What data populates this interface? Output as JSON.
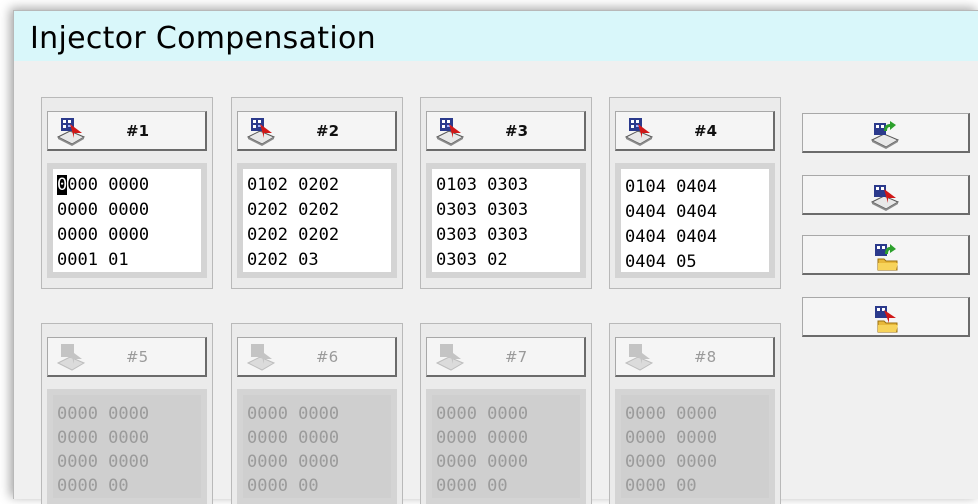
{
  "window": {
    "title": "Injector Compensation"
  },
  "injectors": [
    {
      "label": "#1",
      "enabled": true,
      "lines": [
        "0000 0000",
        "0000 0000",
        "0000 0000",
        "0001 01"
      ]
    },
    {
      "label": "#2",
      "enabled": true,
      "lines": [
        "0102 0202",
        "0202 0202",
        "0202 0202",
        "0202 03"
      ]
    },
    {
      "label": "#3",
      "enabled": true,
      "lines": [
        "0103 0303",
        "0303 0303",
        "0303 0303",
        "0303 02"
      ]
    },
    {
      "label": "#4",
      "enabled": true,
      "lines": [
        "0104 0404",
        "0404 0404",
        "0404 0404",
        "0404 05"
      ]
    },
    {
      "label": "#5",
      "enabled": false,
      "lines": [
        "0000 0000",
        "0000 0000",
        "0000 0000",
        "0000 00"
      ]
    },
    {
      "label": "#6",
      "enabled": false,
      "lines": [
        "0000 0000",
        "0000 0000",
        "0000 0000",
        "0000 00"
      ]
    },
    {
      "label": "#7",
      "enabled": false,
      "lines": [
        "0000 0000",
        "0000 0000",
        "0000 0000",
        "0000 00"
      ]
    },
    {
      "label": "#8",
      "enabled": false,
      "lines": [
        "0000 0000",
        "0000 0000",
        "0000 0000",
        "0000 00"
      ]
    }
  ],
  "side_buttons": [
    {
      "icon": "read-all-ecu-icon"
    },
    {
      "icon": "write-all-ecu-icon"
    },
    {
      "icon": "load-file-icon"
    },
    {
      "icon": "save-file-icon"
    }
  ]
}
